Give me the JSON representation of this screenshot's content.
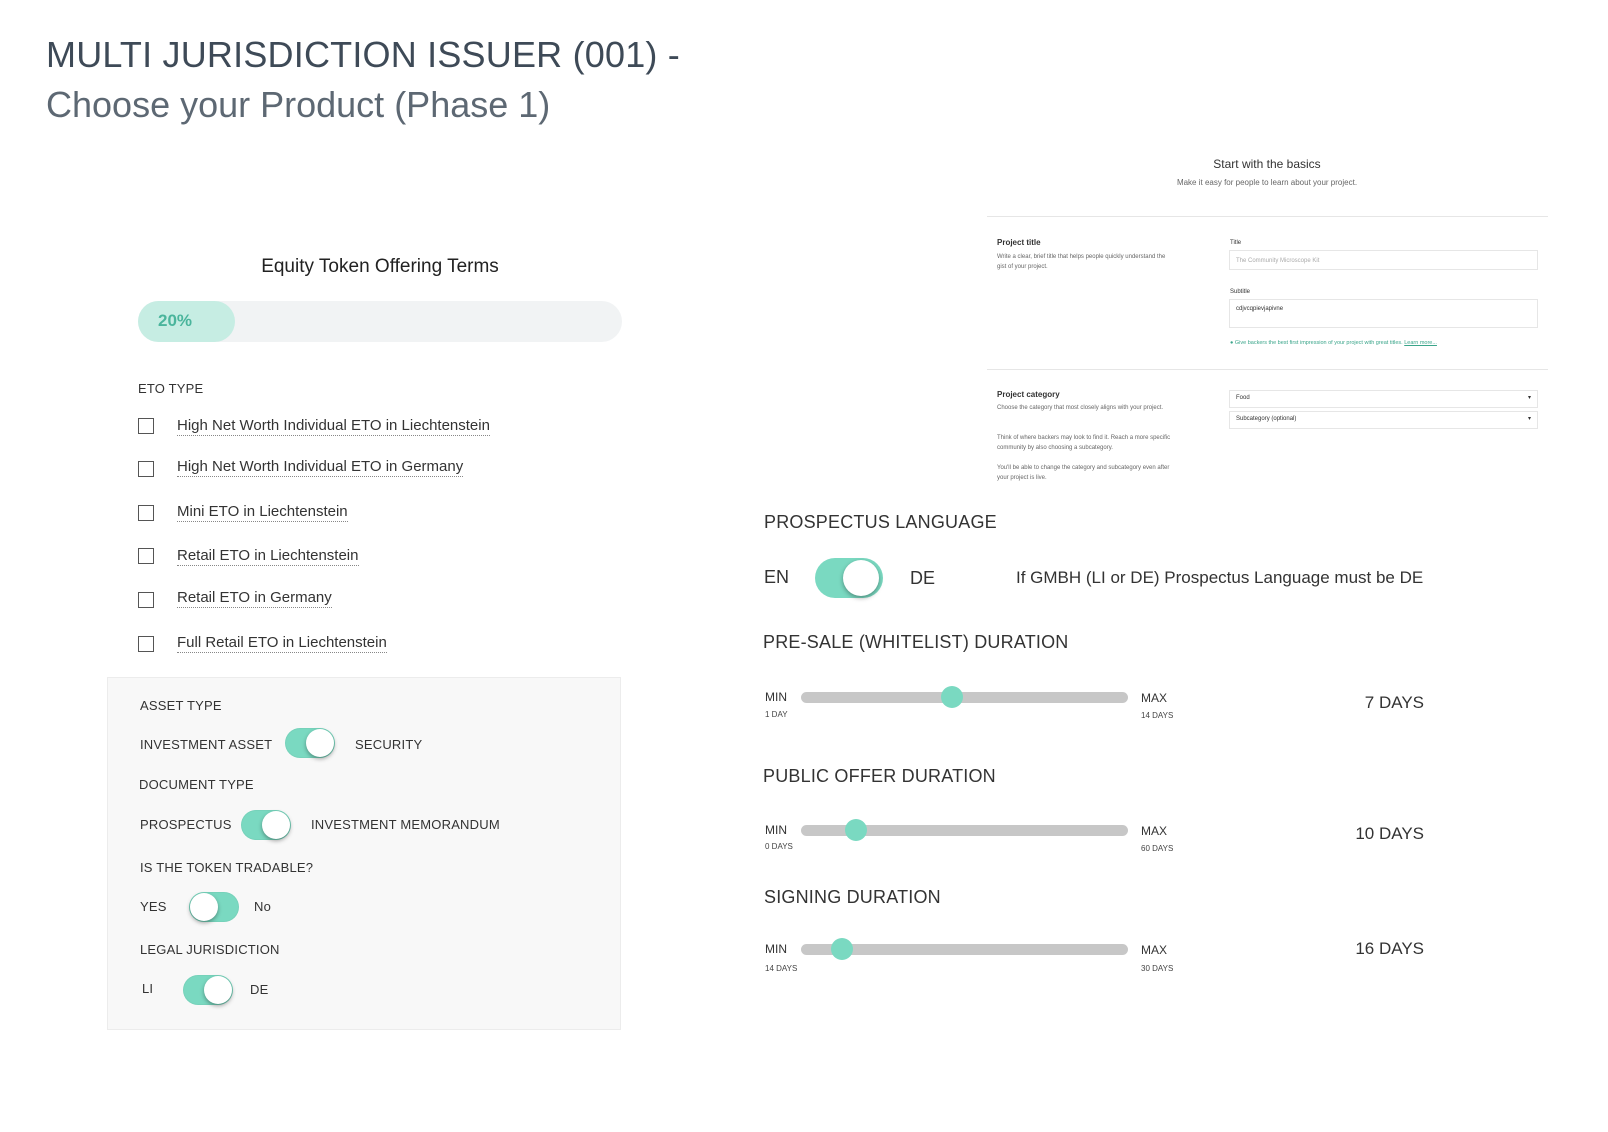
{
  "header": {
    "title_line1": "MULTI JURISDICTION ISSUER (001) -",
    "title_line2": "Choose your Product (Phase 1)"
  },
  "eto_terms": {
    "heading": "Equity Token Offering Terms",
    "progress": {
      "label": "20%",
      "value": 0.2,
      "color": "#c6ede3",
      "text_color": "#4ab59c"
    },
    "eto_type_label": "ETO TYPE",
    "eto_types": [
      {
        "label": "High Net Worth Individual ETO in Liechtenstein",
        "checked": false
      },
      {
        "label": "High Net Worth Individual ETO in Germany",
        "checked": false
      },
      {
        "label": "Mini ETO in Liechtenstein",
        "checked": false
      },
      {
        "label": "Retail ETO in Liechtenstein",
        "checked": false
      },
      {
        "label": "Retail ETO in Germany",
        "checked": false
      },
      {
        "label": "Full Retail ETO in Liechtenstein",
        "checked": false
      }
    ]
  },
  "settings": {
    "asset_type": {
      "label": "ASSET TYPE",
      "left": "INVESTMENT ASSET",
      "right": "SECURITY",
      "state": "right"
    },
    "document_type": {
      "label": "DOCUMENT TYPE",
      "left": "PROSPECTUS",
      "right": "INVESTMENT MEMORANDUM",
      "state": "right"
    },
    "tradable": {
      "label": "IS THE TOKEN TRADABLE?",
      "left": "YES",
      "right": "No",
      "state": "left"
    },
    "jurisdiction": {
      "label": "LEGAL JURISDICTION",
      "left": "LI",
      "right": "DE",
      "state": "right"
    }
  },
  "basics_mock": {
    "title": "Start with the basics",
    "subtitle": "Make it easy for people to learn about your project.",
    "project_title": {
      "label": "Project title",
      "desc": "Write a clear, brief title that helps people quickly understand the gist of your project.",
      "title_label": "Title",
      "title_placeholder": "The Community Microscope Kit",
      "subtitle_label": "Subtitle",
      "subtitle_value": "cdjvcqpievjapivne",
      "hint": "Give backers the best first impression of your project with great titles.",
      "hint_link": "Learn more..."
    },
    "project_category": {
      "label": "Project category",
      "desc1": "Choose the category that most closely aligns with your project.",
      "desc2": "Think of where backers may look to find it. Reach a more specific community by also choosing a subcategory.",
      "desc3": "You'll be able to change the category and subcategory even after your project is live.",
      "category_value": "Food",
      "subcategory_value": "Subcategory (optional)"
    }
  },
  "prospectus_language": {
    "title": "PROSPECTUS LANGUAGE",
    "left": "EN",
    "right": "DE",
    "state": "right",
    "note": "If GMBH (LI or DE) Prospectus Language must be DE"
  },
  "durations": [
    {
      "title": "PRE-SALE (WHITELIST) DURATION",
      "min_label": "MIN",
      "min_sub": "1 DAY",
      "max_label": "MAX",
      "max_sub": "14 DAYS",
      "value_label": "7 DAYS",
      "min": 1,
      "max": 14,
      "value": 7
    },
    {
      "title": "PUBLIC OFFER DURATION",
      "min_label": "MIN",
      "min_sub": "0 DAYS",
      "max_label": "MAX",
      "max_sub": "60 DAYS",
      "value_label": "10 DAYS",
      "min": 0,
      "max": 60,
      "value": 10
    },
    {
      "title": "SIGNING DURATION",
      "min_label": "MIN",
      "min_sub": "14 DAYS",
      "max_label": "MAX",
      "max_sub": "30 DAYS",
      "value_label": "16 DAYS",
      "min": 14,
      "max": 30,
      "value": 16
    }
  ],
  "colors": {
    "accent": "#7ad9c1",
    "track": "#c7c7c7"
  }
}
